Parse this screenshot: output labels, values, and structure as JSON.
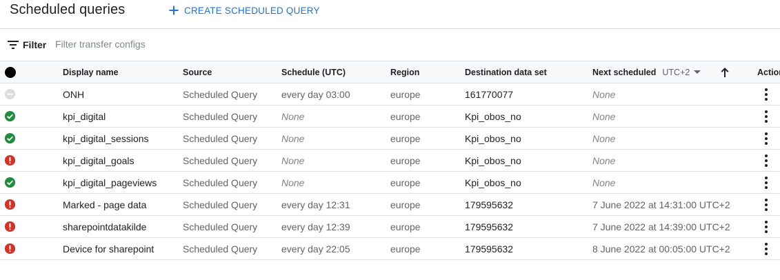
{
  "header": {
    "title": "Scheduled queries",
    "create_label": "CREATE SCHEDULED QUERY"
  },
  "filter": {
    "label": "Filter",
    "placeholder": "Filter transfer configs"
  },
  "columns": {
    "display_name": "Display name",
    "source": "Source",
    "schedule": "Schedule (UTC)",
    "region": "Region",
    "destination": "Destination data set",
    "next_scheduled": "Next scheduled",
    "timezone": "UTC+2",
    "actions": "Actions"
  },
  "colors": {
    "success": "#1e8e3e",
    "error": "#d93025",
    "disabled": "#dadce0",
    "accent": "#1a73e8"
  },
  "rows": [
    {
      "status": "disabled",
      "status_icon": "disabled-icon",
      "name": "ONH",
      "source": "Scheduled Query",
      "schedule": "every day 03:00",
      "region": "europe",
      "destination": "161770077",
      "next": "None"
    },
    {
      "status": "success",
      "status_icon": "check-circle-icon",
      "name": "kpi_digital",
      "source": "Scheduled Query",
      "schedule": "None",
      "region": "europe",
      "destination": "Kpi_obos_no",
      "next": "None"
    },
    {
      "status": "success",
      "status_icon": "check-circle-icon",
      "name": "kpi_digital_sessions",
      "source": "Scheduled Query",
      "schedule": "None",
      "region": "europe",
      "destination": "Kpi_obos_no",
      "next": "None"
    },
    {
      "status": "error",
      "status_icon": "error-icon",
      "name": "kpi_digital_goals",
      "source": "Scheduled Query",
      "schedule": "None",
      "region": "europe",
      "destination": "Kpi_obos_no",
      "next": "None"
    },
    {
      "status": "success",
      "status_icon": "check-circle-icon",
      "name": "kpi_digital_pageviews",
      "source": "Scheduled Query",
      "schedule": "None",
      "region": "europe",
      "destination": "Kpi_obos_no",
      "next": "None"
    },
    {
      "status": "error",
      "status_icon": "error-icon",
      "name": "Marked - page data",
      "source": "Scheduled Query",
      "schedule": "every day 12:31",
      "region": "europe",
      "destination": "179595632",
      "next": "7 June 2022 at 14:31:00 UTC+2"
    },
    {
      "status": "error",
      "status_icon": "error-icon",
      "name": "sharepointdatakilde",
      "source": "Scheduled Query",
      "schedule": "every day 12:39",
      "region": "europe",
      "destination": "179595632",
      "next": "7 June 2022 at 14:39:00 UTC+2"
    },
    {
      "status": "error",
      "status_icon": "error-icon",
      "name": "Device for sharepoint",
      "source": "Scheduled Query",
      "schedule": "every day 22:05",
      "region": "europe",
      "destination": "179595632",
      "next": "8 June 2022 at 00:05:00 UTC+2"
    }
  ]
}
